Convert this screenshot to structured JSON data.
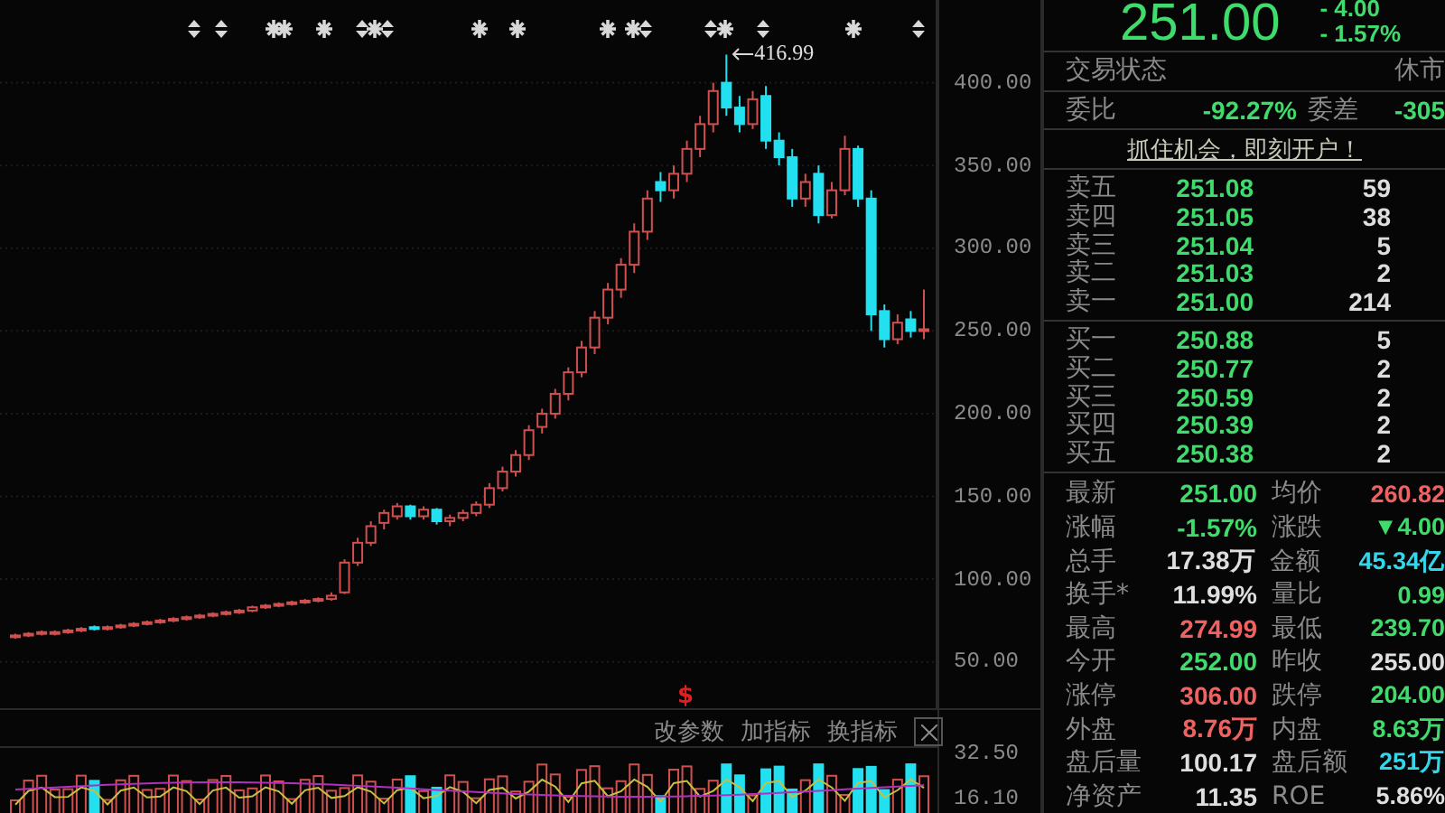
{
  "chart": {
    "event_marks": [
      {
        "kind": "split"
      },
      {
        "kind": "split"
      },
      {
        "kind": "star"
      },
      {
        "kind": "star"
      },
      {
        "kind": "star"
      },
      {
        "kind": "split"
      },
      {
        "kind": "star"
      },
      {
        "kind": "split"
      },
      {
        "kind": "star"
      },
      {
        "kind": "star"
      },
      {
        "kind": "star"
      },
      {
        "kind": "star"
      },
      {
        "kind": "split"
      },
      {
        "kind": "split"
      },
      {
        "kind": "star"
      },
      {
        "kind": "split"
      },
      {
        "kind": "star"
      },
      {
        "kind": "split"
      }
    ],
    "peak_label": "416.99",
    "chart_data": {
      "type": "candlestick",
      "ylim": [
        22,
        450
      ],
      "ohlc": [
        [
          65,
          67,
          64,
          66
        ],
        [
          66,
          68,
          65,
          67
        ],
        [
          67,
          69,
          66,
          68
        ],
        [
          68,
          69,
          66,
          68
        ],
        [
          68,
          70,
          67,
          69
        ],
        [
          69,
          71,
          68,
          70
        ],
        [
          71,
          72,
          69,
          70
        ],
        [
          70,
          72,
          69,
          71
        ],
        [
          71,
          73,
          70,
          72
        ],
        [
          73,
          74,
          71,
          73
        ],
        [
          73,
          75,
          72,
          74
        ],
        [
          74,
          76,
          73,
          75
        ],
        [
          76,
          77,
          74,
          76
        ],
        [
          76,
          78,
          75,
          77
        ],
        [
          77,
          79,
          76,
          78
        ],
        [
          79,
          80,
          77,
          79
        ],
        [
          79,
          81,
          78,
          80
        ],
        [
          80,
          82,
          79,
          81
        ],
        [
          81,
          84,
          80,
          83
        ],
        [
          83,
          85,
          82,
          84
        ],
        [
          85,
          86,
          83,
          85
        ],
        [
          85,
          87,
          84,
          86
        ],
        [
          86,
          88,
          85,
          87
        ],
        [
          87,
          89,
          86,
          88
        ],
        [
          88,
          92,
          87,
          90
        ],
        [
          92,
          112,
          91,
          110
        ],
        [
          110,
          125,
          108,
          122
        ],
        [
          122,
          135,
          120,
          132
        ],
        [
          134,
          142,
          130,
          140
        ],
        [
          138,
          146,
          136,
          144
        ],
        [
          144,
          145,
          136,
          138
        ],
        [
          138,
          144,
          136,
          142
        ],
        [
          142,
          143,
          133,
          135
        ],
        [
          135,
          139,
          132,
          137
        ],
        [
          137,
          142,
          135,
          140
        ],
        [
          140,
          147,
          138,
          145
        ],
        [
          145,
          158,
          143,
          155
        ],
        [
          155,
          168,
          153,
          165
        ],
        [
          165,
          178,
          162,
          175
        ],
        [
          175,
          193,
          172,
          190
        ],
        [
          192,
          203,
          188,
          200
        ],
        [
          200,
          215,
          197,
          212
        ],
        [
          212,
          228,
          208,
          225
        ],
        [
          225,
          244,
          222,
          240
        ],
        [
          240,
          262,
          236,
          258
        ],
        [
          258,
          279,
          254,
          275
        ],
        [
          275,
          294,
          270,
          290
        ],
        [
          290,
          315,
          285,
          310
        ],
        [
          310,
          335,
          305,
          330
        ],
        [
          340,
          346,
          328,
          335
        ],
        [
          335,
          350,
          330,
          345
        ],
        [
          345,
          365,
          340,
          360
        ],
        [
          360,
          380,
          355,
          375
        ],
        [
          375,
          400,
          370,
          395
        ],
        [
          400,
          416.99,
          380,
          385
        ],
        [
          385,
          392,
          370,
          375
        ],
        [
          375,
          395,
          372,
          390
        ],
        [
          392,
          398,
          360,
          365
        ],
        [
          365,
          370,
          350,
          355
        ],
        [
          355,
          360,
          325,
          330
        ],
        [
          330,
          345,
          325,
          340
        ],
        [
          345,
          350,
          315,
          320
        ],
        [
          320,
          340,
          318,
          335
        ],
        [
          335,
          368,
          332,
          360
        ],
        [
          360,
          362,
          325,
          330
        ],
        [
          330,
          335,
          250,
          260
        ],
        [
          262,
          266,
          240,
          245
        ],
        [
          245,
          260,
          242,
          255
        ],
        [
          257,
          262,
          246,
          250
        ],
        [
          250,
          275,
          245,
          251
        ]
      ],
      "yticks": [
        {
          "value": 400,
          "label": "400.00"
        },
        {
          "value": 350,
          "label": "350.00"
        },
        {
          "value": 300,
          "label": "300.00"
        },
        {
          "value": 250,
          "label": "250.00"
        },
        {
          "value": 200,
          "label": "200.00"
        },
        {
          "value": 150,
          "label": "150.00"
        },
        {
          "value": 100,
          "label": "100.00"
        },
        {
          "value": 50,
          "label": "50.00"
        }
      ],
      "grid": true
    },
    "dividend_mark": "$",
    "indicator_toolbar": [
      "改参数",
      "加指标",
      "换指标"
    ],
    "volume_axis": [
      "32.50",
      "16.10"
    ]
  },
  "quote": {
    "price": "251.00",
    "change": "- 4.00",
    "change_pct": "- 1.57%"
  },
  "status": {
    "label": "交易状态",
    "value": "休市"
  },
  "commission": {
    "ratio_label": "委比",
    "ratio": "-92.27%",
    "diff_label": "委差",
    "diff": "-305"
  },
  "promo_link": "抓住机会，即刻开户！",
  "sells": [
    {
      "label": "卖五",
      "price": "251.08",
      "volume": "59"
    },
    {
      "label": "卖四",
      "price": "251.05",
      "volume": "38"
    },
    {
      "label": "卖三",
      "price": "251.04",
      "volume": "5"
    },
    {
      "label": "卖二",
      "price": "251.03",
      "volume": "2"
    },
    {
      "label": "卖一",
      "price": "251.00",
      "volume": "214"
    }
  ],
  "buys": [
    {
      "label": "买一",
      "price": "250.88",
      "volume": "5"
    },
    {
      "label": "买二",
      "price": "250.77",
      "volume": "2"
    },
    {
      "label": "买三",
      "price": "250.59",
      "volume": "2"
    },
    {
      "label": "买四",
      "price": "250.39",
      "volume": "2"
    },
    {
      "label": "买五",
      "price": "250.38",
      "volume": "2"
    }
  ],
  "stats": [
    {
      "cells": [
        {
          "label": "最新",
          "value": "251.00",
          "color": "#3fdc6c"
        },
        {
          "label": "均价",
          "value": "260.82",
          "color": "#f06262"
        }
      ]
    },
    {
      "cells": [
        {
          "label": "涨幅",
          "value": "-1.57%",
          "color": "#3fdc6c"
        },
        {
          "label": "涨跌",
          "value": "▼4.00",
          "color": "#3fdc6c"
        }
      ]
    },
    {
      "cells": [
        {
          "label": "总手",
          "value": "17.38万",
          "color": "#dedede"
        },
        {
          "label": "金额",
          "value": "45.34亿",
          "color": "#33d6ea"
        }
      ]
    },
    {
      "cells": [
        {
          "label": "换手*",
          "value": "11.99%",
          "color": "#dedede"
        },
        {
          "label": "量比",
          "value": "0.99",
          "color": "#3fdc6c"
        }
      ]
    },
    {
      "cells": [
        {
          "label": "最高",
          "value": "274.99",
          "color": "#f06262"
        },
        {
          "label": "最低",
          "value": "239.70",
          "color": "#3fdc6c"
        }
      ]
    },
    {
      "cells": [
        {
          "label": "今开",
          "value": "252.00",
          "color": "#3fdc6c"
        },
        {
          "label": "昨收",
          "value": "255.00",
          "color": "#dedede"
        }
      ]
    },
    {
      "cells": [
        {
          "label": "涨停",
          "value": "306.00",
          "color": "#f06262"
        },
        {
          "label": "跌停",
          "value": "204.00",
          "color": "#3fdc6c"
        }
      ]
    },
    {
      "cells": [
        {
          "label": "外盘",
          "value": "8.76万",
          "color": "#f06262"
        },
        {
          "label": "内盘",
          "value": "8.63万",
          "color": "#3fdc6c"
        }
      ]
    },
    {
      "cells": [
        {
          "label": "盘后量",
          "value": "100.17",
          "color": "#dedede"
        },
        {
          "label": "盘后额",
          "value": "251万",
          "color": "#33d6ea"
        }
      ]
    },
    {
      "cells": [
        {
          "label": "净资产",
          "value": "11.35",
          "color": "#dedede"
        },
        {
          "label": "ROE",
          "value": "5.86%",
          "color": "#dedede"
        }
      ]
    }
  ]
}
